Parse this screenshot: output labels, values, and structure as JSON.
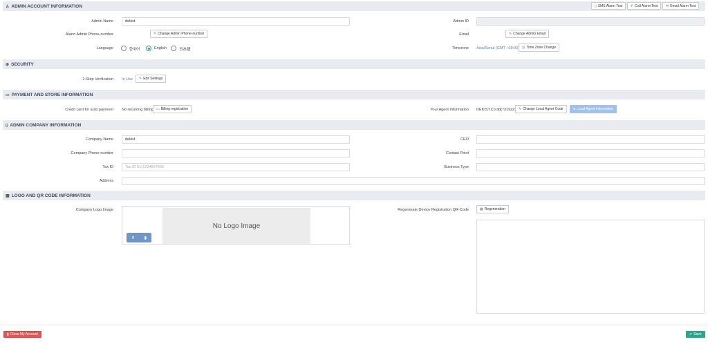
{
  "sections": {
    "admin": "ADMIN ACCOUNT INFORMATION",
    "security": "SECURITY",
    "payment": "PAYMENT AND STORE INFORMATION",
    "company": "ADMIN COMPANY INFORMATION",
    "logo": "LOGO AND QR CODE INFORMATION"
  },
  "tests": {
    "sms": "SMS Alarm Test",
    "call": "Call Alarm Test",
    "email": "Email Alarm Test"
  },
  "admin": {
    "name_label": "Admin Name",
    "name_value": "dekist",
    "id_label": "Admin ID",
    "id_value": "",
    "phone_label": "Alarm Admin Phone-number",
    "phone_button": "Change Admin Phone-number",
    "email_label": "Email",
    "email_button": "Change Admin Email",
    "language_label": "Language",
    "languages": [
      "한국어",
      "English",
      "日本語"
    ],
    "selected_language": "English",
    "timezone_label": "Timezone",
    "timezone_value": "Asia/Seoul (GMT +09:00)",
    "timezone_button": "Time Zone Change"
  },
  "security": {
    "label": "2-Step Verification",
    "status": "In Use",
    "button": "Edit Settings"
  },
  "payment": {
    "card_label": "Credit card for auto payment",
    "card_value": "No recurring billing",
    "billing_button": "Billing registration",
    "agent_label": "Your Agent Information",
    "agent_value": "DEKIST.Co.ltd(731922)",
    "agent_change_button": "Change Local Agent Code",
    "agent_info_button": "Local Agent Information"
  },
  "company": {
    "name_label": "Company Name",
    "name_value": "dekist",
    "ceo_label": "CEO",
    "ceo_value": "",
    "phone_label": "Company Phone-number",
    "phone_value": "",
    "contact_label": "Contact Point",
    "contact_value": "",
    "tax_label": "Tax ID",
    "tax_placeholder": "Tax ID Ex)1234567890",
    "business_label": "Business Type",
    "business_value": "",
    "address_label": "Address",
    "address_value": ""
  },
  "logo": {
    "label": "Company Logo Image",
    "empty_text": "No Logo Image",
    "qr_label": "Regenerate Device Registration QR-Code",
    "qr_button": "Regeneration"
  },
  "footer": {
    "close_button": "Close My Account",
    "save_button": "Save"
  },
  "colors": {
    "accent": "#2aa68a",
    "danger": "#e25656",
    "link": "#4a86c7",
    "header_bg": "#e8ebf0"
  }
}
